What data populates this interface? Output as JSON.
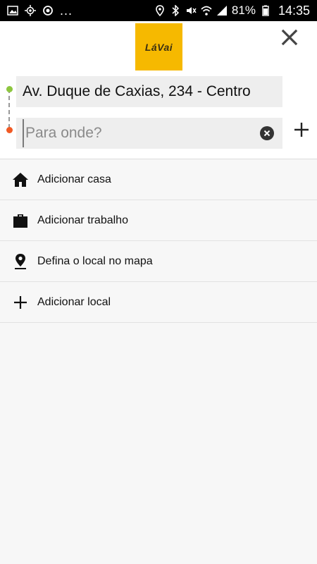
{
  "status_bar": {
    "battery": "81%",
    "time": "14:35",
    "more": "..."
  },
  "header": {
    "logo_text": "LáVai"
  },
  "route": {
    "origin": "Av. Duque de Caxias, 234 - Centro",
    "destination_value": "",
    "destination_placeholder": "Para onde?"
  },
  "shortcuts": [
    {
      "label": "Adicionar casa",
      "icon": "home-icon"
    },
    {
      "label": "Adicionar trabalho",
      "icon": "briefcase-icon"
    },
    {
      "label": "Defina o local no mapa",
      "icon": "map-pin-icon"
    },
    {
      "label": "Adicionar local",
      "icon": "plus-icon"
    }
  ],
  "colors": {
    "brand_yellow": "#f6b900",
    "origin_dot": "#8dc63f",
    "destination_dot": "#f15a24"
  }
}
